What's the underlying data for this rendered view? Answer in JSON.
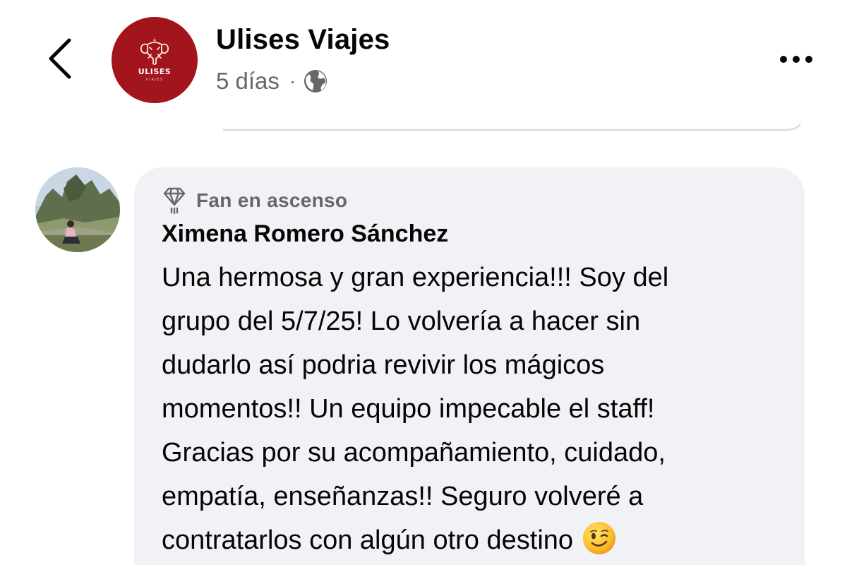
{
  "header": {
    "back_icon": "chevron-left-icon",
    "page_name": "Ulises Viajes",
    "post_age": "5 días",
    "separator": "·",
    "audience_icon": "globe-icon",
    "more_icon": "more-horizontal-icon",
    "logo": {
      "text": "ULISES",
      "subtext": "VIAJES",
      "background_color": "#a3151d"
    }
  },
  "comment": {
    "badge": {
      "icon": "diamond-icon",
      "label": "Fan en ascenso"
    },
    "author": "Ximena Romero Sánchez",
    "text_lines": [
      "Una hermosa y gran experiencia!!! Soy del",
      "grupo del 5/7/25! Lo volvería a hacer sin",
      "dudarlo así podria revivir los mágicos",
      "momentos!! Un equipo impecable el staff!",
      "Gracias por su acompañamiento, cuidado,",
      "empatía, enseñanzas!! Seguro volveré a",
      "contratarlos con algún otro destino"
    ],
    "trailing_emoji": "winking-face-emoji",
    "bubble_color": "#f0f2f5"
  }
}
